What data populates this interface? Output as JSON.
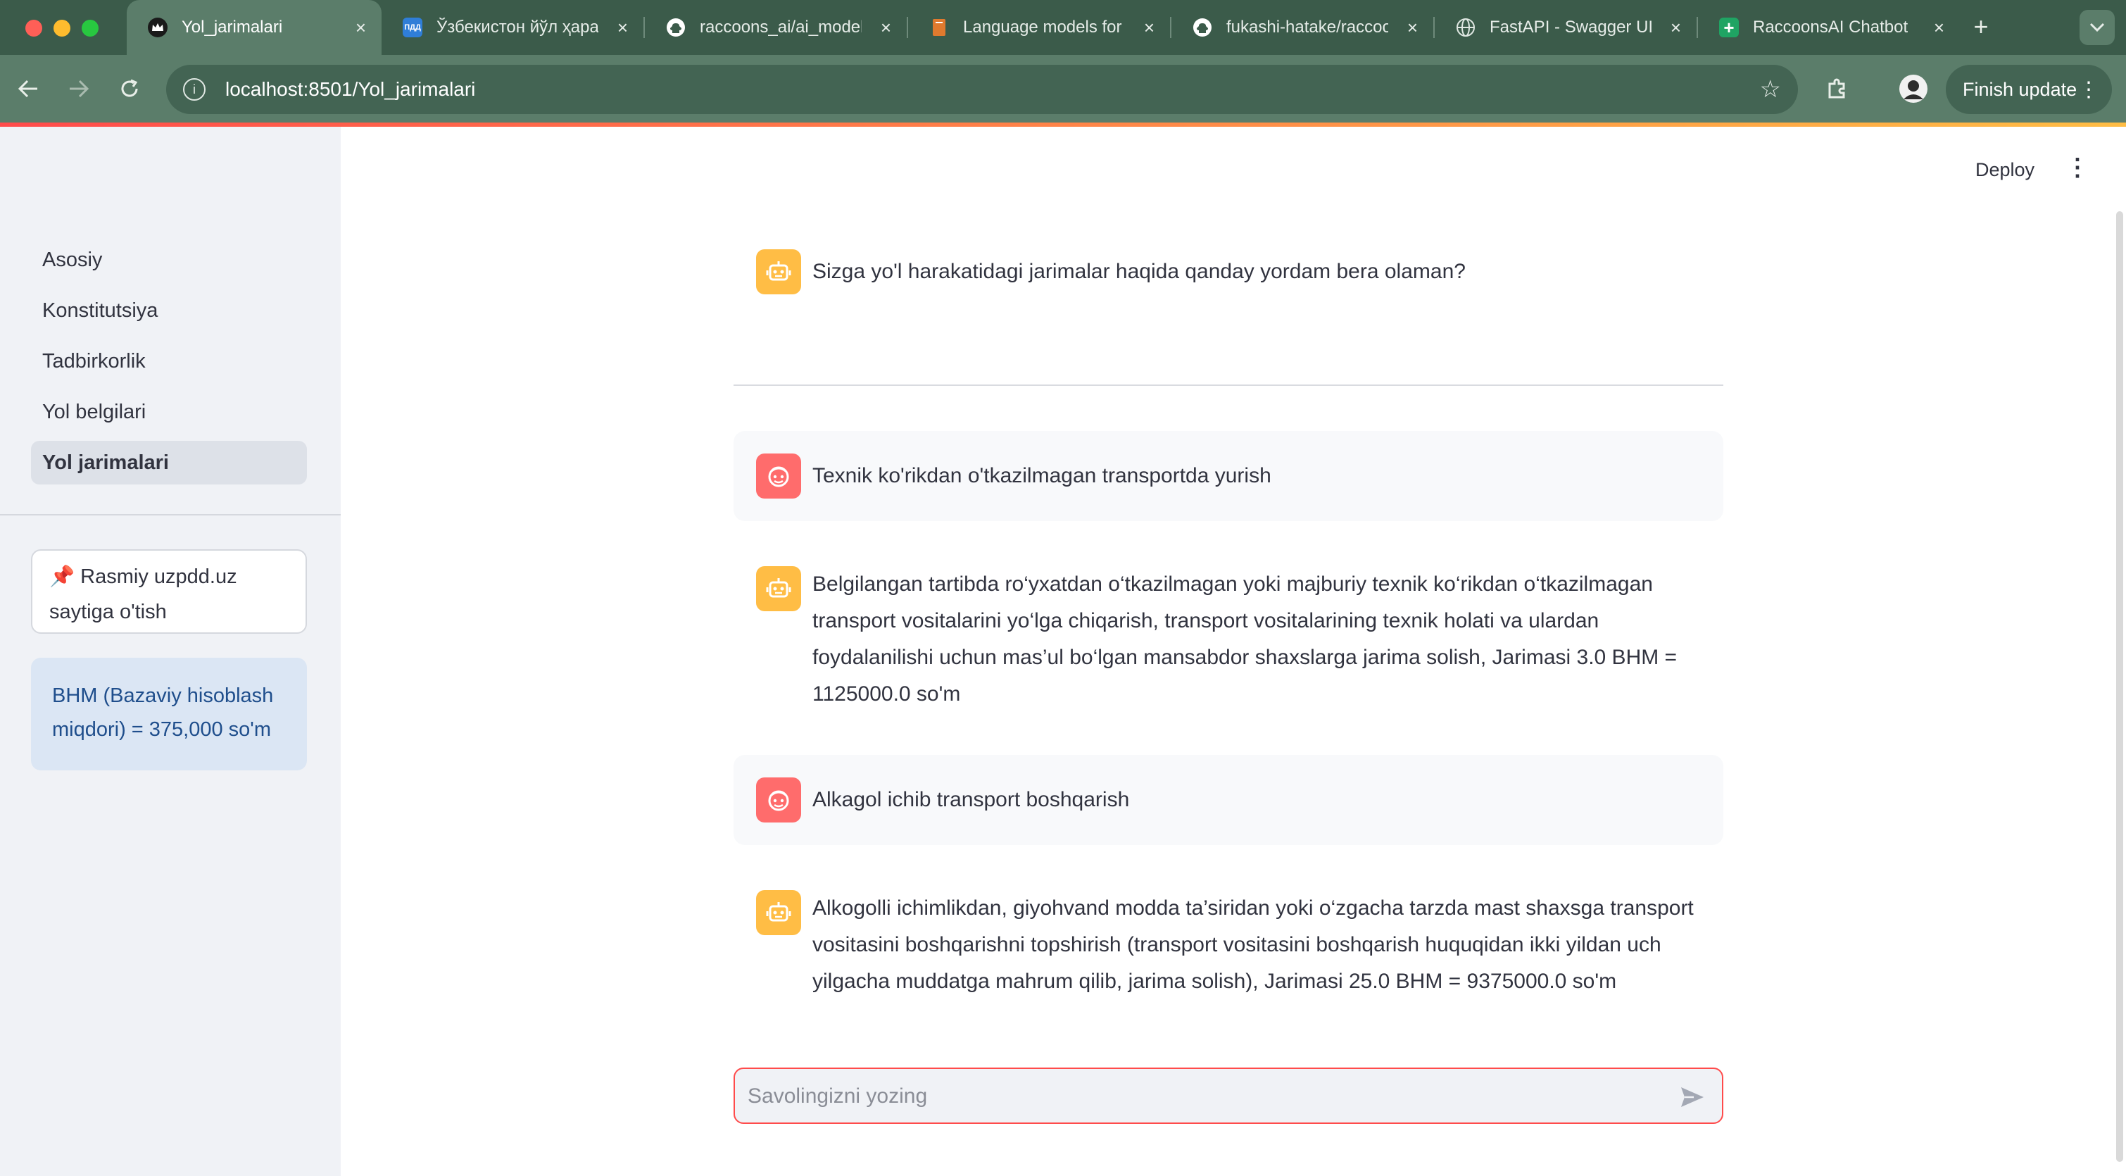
{
  "browser": {
    "tabs": [
      {
        "title": "Yol_jarimalari",
        "active": true,
        "favicon": "crown-icon"
      },
      {
        "title": "Ўзбекистон йўл ҳаракати",
        "active": false,
        "favicon": "pdd-icon",
        "favicon_text": "ПДД"
      },
      {
        "title": "raccoons_ai/ai_models",
        "active": false,
        "favicon": "github-icon"
      },
      {
        "title": "Language models for",
        "active": false,
        "favicon": "book-icon"
      },
      {
        "title": "fukashi-hatake/raccoons",
        "active": false,
        "favicon": "github-icon"
      },
      {
        "title": "FastAPI - Swagger UI",
        "active": false,
        "favicon": "globe-icon"
      },
      {
        "title": "RaccoonsAI Chatbot",
        "active": false,
        "favicon": "sheets-icon"
      }
    ],
    "new_tab": "+",
    "url": "localhost:8501/Yol_jarimalari",
    "finish_update": "Finish update"
  },
  "sidebar": {
    "items": [
      {
        "label": "Asosiy",
        "active": false
      },
      {
        "label": "Konstitutsiya",
        "active": false
      },
      {
        "label": "Tadbirkorlik",
        "active": false
      },
      {
        "label": "Yol belgilari",
        "active": false
      },
      {
        "label": "Yol jarimalari",
        "active": true
      }
    ],
    "link_button_icon": "📌",
    "link_button_line1": "Rasmiy uzpdd.uz",
    "link_button_line2": "saytiga o'tish",
    "info_line1": "BHM (Bazaviy hisoblash",
    "info_line2": "miqdori) = 375,000 so'm"
  },
  "header": {
    "deploy": "Deploy",
    "menu": "⋮"
  },
  "chat": {
    "greeting": "Sizga yo'l harakatidagi jarimalar haqida qanday yordam bera olaman?",
    "messages": [
      {
        "role": "user",
        "text": "Texnik ko'rikdan o'tkazilmagan transportda yurish"
      },
      {
        "role": "assistant",
        "text": "Belgilangan tartibda ro‘yxatdan o‘tkazilmagan yoki majburiy texnik ko‘rikdan o‘tkazilmagan transport vositalarini yo‘lga chiqarish, transport vositalarining texnik holati va ulardan foydalanilishi uchun mas’ul bo‘lgan mansabdor shaxslarga jarima solish, Jarimasi 3.0 BHM = 1125000.0 so'm"
      },
      {
        "role": "user",
        "text": "Alkagol ichib transport boshqarish"
      },
      {
        "role": "assistant",
        "text": "Alkogolli ichimlikdan, giyohvand modda ta’siridan yoki o‘zgacha tarzda mast shaxsga transport vositasini boshqarishni topshirish (transport vositasini boshqarish huquqidan ikki yildan uch yilgacha muddatga mahrum qilib, jarima solish), Jarimasi 25.0 BHM = 9375000.0 so'm"
      }
    ],
    "input_placeholder": "Savolingizni yozing"
  },
  "colors": {
    "accent": "#ff4b4b",
    "bot_avatar": "#ffbd45",
    "user_avatar": "#ff6c6c",
    "sidebar_bg": "#f0f2f6",
    "info_bg": "#dbe6f4",
    "browser_chrome": "#5b7d6a"
  }
}
